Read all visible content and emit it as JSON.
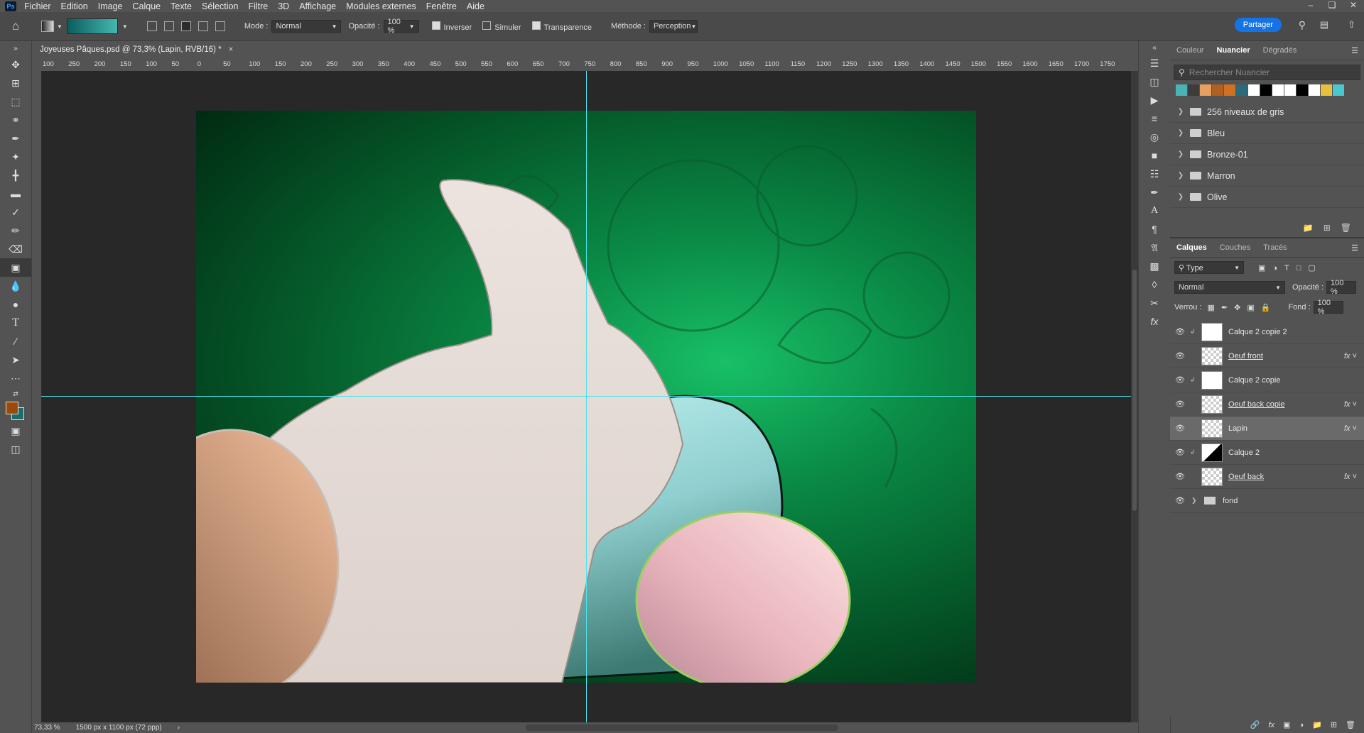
{
  "app": {
    "logo": "Ps"
  },
  "menu": [
    "Fichier",
    "Edition",
    "Image",
    "Calque",
    "Texte",
    "Sélection",
    "Filtre",
    "3D",
    "Affichage",
    "Modules externes",
    "Fenêtre",
    "Aide"
  ],
  "options": {
    "mode_label": "Mode :",
    "mode_value": "Normal",
    "opacity_label": "Opacité :",
    "opacity_value": "100 %",
    "inverser": "Inverser",
    "simuler": "Simuler",
    "transparence": "Transparence",
    "methode_label": "Méthode :",
    "methode_value": "Perception",
    "share": "Partager"
  },
  "document": {
    "tab_title": "Joyeuses Pâques.psd @ 73,3% (Lapin, RVB/16) *"
  },
  "ruler_labels": [
    "100",
    "250",
    "200",
    "150",
    "100",
    "50",
    "0",
    "50",
    "100",
    "150",
    "200",
    "250",
    "300",
    "350",
    "400",
    "450",
    "500",
    "550",
    "600",
    "650",
    "700",
    "750",
    "800",
    "850",
    "900",
    "950",
    "1000",
    "1050",
    "1100",
    "1150",
    "1200",
    "1250",
    "1300",
    "1350",
    "1400",
    "1450",
    "1500",
    "1550",
    "1600",
    "1650",
    "1700",
    "1750"
  ],
  "status": {
    "zoom": "73,33 %",
    "dims": "1500 px x 1100 px (72 ppp)"
  },
  "swatch_panel": {
    "tabs": [
      "Couleur",
      "Nuancier",
      "Dégradés"
    ],
    "active_tab": "Nuancier",
    "search_placeholder": "Rechercher Nuancier",
    "colors": [
      "#4ab4b4",
      "#3c3c3c",
      "#e8a060",
      "#b06020",
      "#d07020",
      "#2a6a7a",
      "#ffffff",
      "#000000",
      "#ffffff",
      "#ffffff",
      "#000000",
      "#ffffff",
      "#e8c040",
      "#4ac8d0"
    ],
    "folders": [
      "256 niveaux de gris",
      "Bleu",
      "Bronze-01",
      "Marron",
      "Olive"
    ]
  },
  "layers_panel": {
    "tabs": [
      "Calques",
      "Couches",
      "Tracés"
    ],
    "active_tab": "Calques",
    "filter": "Type",
    "blend": "Normal",
    "opacity_label": "Opacité :",
    "opacity": "100 %",
    "lock_label": "Verrou :",
    "fill_label": "Fond :",
    "fill": "100 %",
    "layers": [
      {
        "name": "Calque 2 copie 2",
        "thumb": "white",
        "clip": true,
        "fx": false,
        "underline": false
      },
      {
        "name": "Oeuf front",
        "thumb": "checker",
        "clip": false,
        "fx": true,
        "underline": true
      },
      {
        "name": "Calque 2 copie",
        "thumb": "white",
        "clip": true,
        "fx": false,
        "underline": false
      },
      {
        "name": "Oeuf back copie",
        "thumb": "checker",
        "clip": false,
        "fx": true,
        "underline": true
      },
      {
        "name": "Lapin",
        "thumb": "checker",
        "clip": false,
        "fx": true,
        "underline": false,
        "selected": true
      },
      {
        "name": "Calque 2",
        "thumb": "bw",
        "clip": true,
        "fx": false,
        "underline": false
      },
      {
        "name": "Oeuf back",
        "thumb": "checker",
        "clip": false,
        "fx": true,
        "underline": true
      },
      {
        "name": "fond",
        "thumb": "folder",
        "clip": false,
        "fx": false,
        "underline": false
      }
    ]
  }
}
